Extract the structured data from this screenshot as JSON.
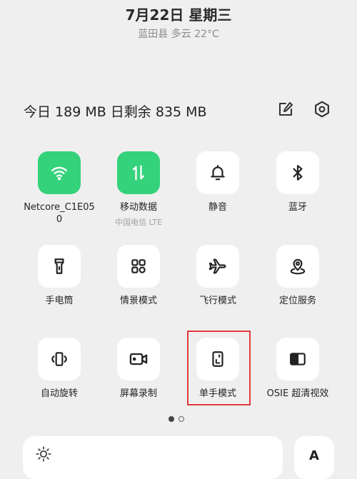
{
  "header": {
    "date": "7月22日  星期三",
    "weather": "蓝田县 多云 22°C"
  },
  "usage": {
    "text": "今日 189 MB 日剩余 835 MB"
  },
  "icons": {
    "edit": "edit-icon",
    "settings": "settings-icon"
  },
  "tiles": [
    {
      "label": "Netcore_C1E050",
      "sub": "",
      "icon": "wifi-icon",
      "active": true
    },
    {
      "label": "移动数据",
      "sub": "中国电信   LTE",
      "icon": "mobile-data-icon",
      "active": true
    },
    {
      "label": "静音",
      "sub": "",
      "icon": "bell-icon",
      "active": false
    },
    {
      "label": "蓝牙",
      "sub": "",
      "icon": "bluetooth-icon",
      "active": false
    },
    {
      "label": "手电筒",
      "sub": "",
      "icon": "flashlight-icon",
      "active": false
    },
    {
      "label": "情景模式",
      "sub": "",
      "icon": "scene-mode-icon",
      "active": false
    },
    {
      "label": "飞行模式",
      "sub": "",
      "icon": "airplane-icon",
      "active": false
    },
    {
      "label": "定位服务",
      "sub": "",
      "icon": "location-icon",
      "active": false
    },
    {
      "label": "自动旋转",
      "sub": "",
      "icon": "auto-rotate-icon",
      "active": false
    },
    {
      "label": "屏幕录制",
      "sub": "",
      "icon": "screen-record-icon",
      "active": false
    },
    {
      "label": "单手模式",
      "sub": "",
      "icon": "one-hand-mode-icon",
      "active": false
    },
    {
      "label": "OSIE 超清视效",
      "sub": "",
      "icon": "osie-icon",
      "active": false
    }
  ],
  "pager": {
    "pages": 2,
    "current": 1
  },
  "brightness": {
    "icon": "brightness-icon"
  },
  "font_button": {
    "label": "A"
  },
  "colors": {
    "accent": "#34d27b",
    "highlight": "#e23b3b",
    "background": "#efefef"
  }
}
